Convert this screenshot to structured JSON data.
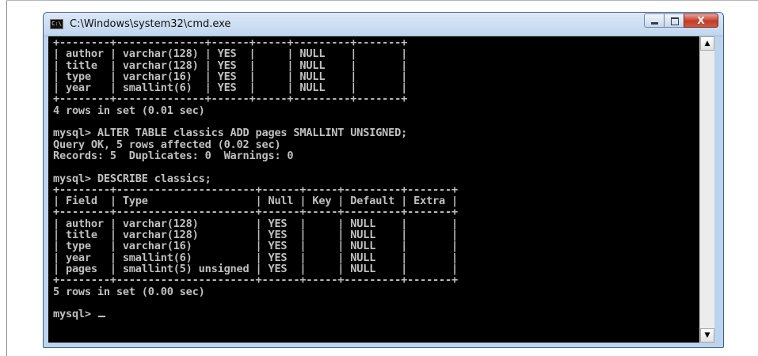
{
  "window": {
    "title": "C:\\Windows\\system32\\cmd.exe",
    "icon_label": "C:\\",
    "icon": "cmd-icon",
    "buttons": {
      "minimize": "minimize-icon",
      "maximize": "maximize-icon",
      "close": "X"
    }
  },
  "console": {
    "lines": [
      "+--------+--------------+------+-----+---------+-------+",
      "| author | varchar(128) | YES  |     | NULL    |       |",
      "| title  | varchar(128) | YES  |     | NULL    |       |",
      "| type   | varchar(16)  | YES  |     | NULL    |       |",
      "| year   | smallint(6)  | YES  |     | NULL    |       |",
      "+--------+--------------+------+-----+---------+-------+",
      "4 rows in set (0.01 sec)",
      "",
      "mysql> ALTER TABLE classics ADD pages SMALLINT UNSIGNED;",
      "Query OK, 5 rows affected (0.02 sec)",
      "Records: 5  Duplicates: 0  Warnings: 0",
      "",
      "mysql> DESCRIBE classics;",
      "+--------+----------------------+------+-----+---------+-------+",
      "| Field  | Type                 | Null | Key | Default | Extra |",
      "+--------+----------------------+------+-----+---------+-------+",
      "| author | varchar(128)         | YES  |     | NULL    |       |",
      "| title  | varchar(128)         | YES  |     | NULL    |       |",
      "| type   | varchar(16)          | YES  |     | NULL    |       |",
      "| year   | smallint(6)          | YES  |     | NULL    |       |",
      "| pages  | smallint(5) unsigned | YES  |     | NULL    |       |",
      "+--------+----------------------+------+-----+---------+-------+",
      "5 rows in set (0.00 sec)",
      "",
      "mysql> "
    ]
  },
  "scrollbar": {
    "up_icon": "▲",
    "down_icon": "▼"
  },
  "colors": {
    "console_bg": "#000000",
    "console_fg": "#c0c0c0",
    "frame": "#bcd4ec",
    "close": "#c43a28"
  }
}
